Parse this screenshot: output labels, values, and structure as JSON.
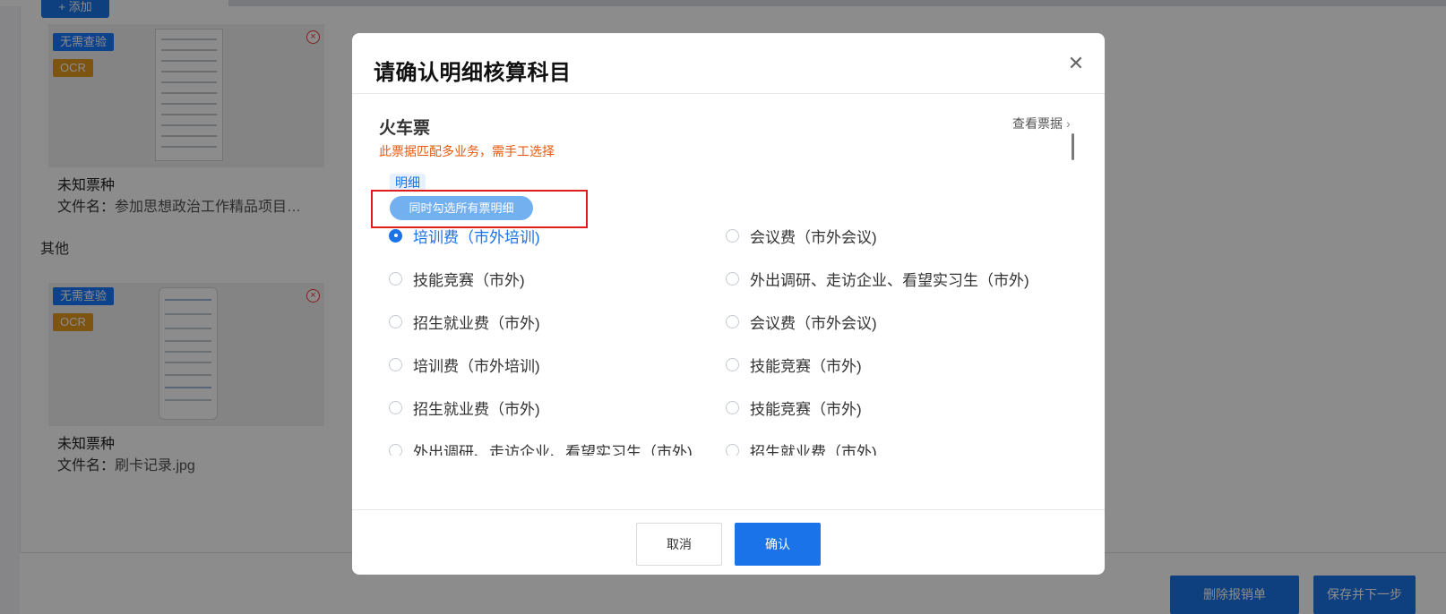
{
  "background": {
    "add_button": "+ 添加",
    "other_section": "其他",
    "attachments": [
      {
        "badge_verify": "无需查验",
        "badge_ocr": "OCR",
        "type": "未知票种",
        "file_prefix": "文件名：",
        "file_name": "参加思想政治工作精品项目…"
      },
      {
        "badge_verify": "无需查验",
        "badge_ocr": "OCR",
        "type": "未知票种",
        "file_prefix": "文件名：",
        "file_name": "刷卡记录.jpg"
      }
    ],
    "bottom_buttons": {
      "delete": "删除报销单",
      "save_next": "保存并下一步"
    }
  },
  "modal": {
    "title": "请确认明细核算科目",
    "ticket_title": "火车票",
    "ticket_warning": "此票据匹配多业务，需手工选择",
    "view_ticket": "查看票据",
    "detail_tag": "明细",
    "select_all": "同时勾选所有票明细",
    "options": [
      {
        "label": "培训费（市外培训)",
        "checked": true
      },
      {
        "label": "会议费（市外会议)",
        "checked": false
      },
      {
        "label": "技能竞赛（市外)",
        "checked": false
      },
      {
        "label": "外出调研、走访企业、看望实习生（市外)",
        "checked": false
      },
      {
        "label": "招生就业费（市外)",
        "checked": false
      },
      {
        "label": "会议费（市外会议)",
        "checked": false
      },
      {
        "label": "培训费（市外培训)",
        "checked": false
      },
      {
        "label": "技能竞赛（市外)",
        "checked": false
      },
      {
        "label": "招生就业费（市外)",
        "checked": false
      },
      {
        "label": "技能竞赛（市外)",
        "checked": false
      },
      {
        "label": "外出调研、走访企业、看望实习生（市外)",
        "checked": false
      },
      {
        "label": "招生就业费（市外)",
        "checked": false
      }
    ],
    "cancel": "取消",
    "confirm": "确认"
  },
  "colors": {
    "primary": "#1a73e8",
    "warning": "#e8590c",
    "highlight_box": "#e21c1c"
  }
}
